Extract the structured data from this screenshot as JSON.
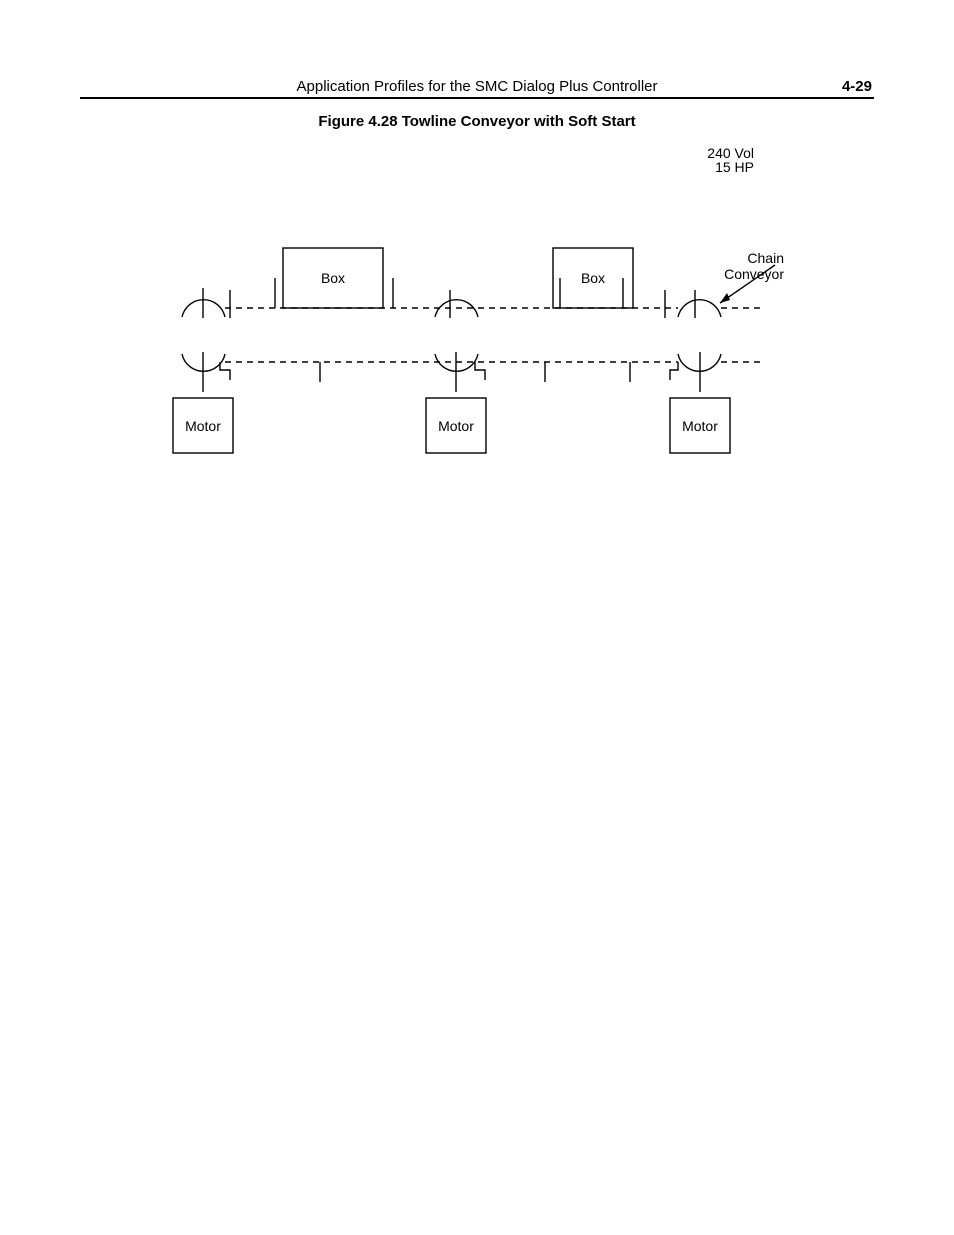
{
  "header": {
    "title": "Application Profiles for the SMC Dialog Plus Controller",
    "page_number": "4-29"
  },
  "figure": {
    "caption": "Figure 4.28 Towline Conveyor with Soft Start",
    "spec_voltage": "240 Vol",
    "spec_power": "15 HP",
    "annotation_chain_l1": "Chain",
    "annotation_chain_l2": "Conveyor",
    "labels": {
      "box1": "Box",
      "box2": "Box",
      "motor1": "Motor",
      "motor2": "Motor",
      "motor3": "Motor"
    }
  }
}
